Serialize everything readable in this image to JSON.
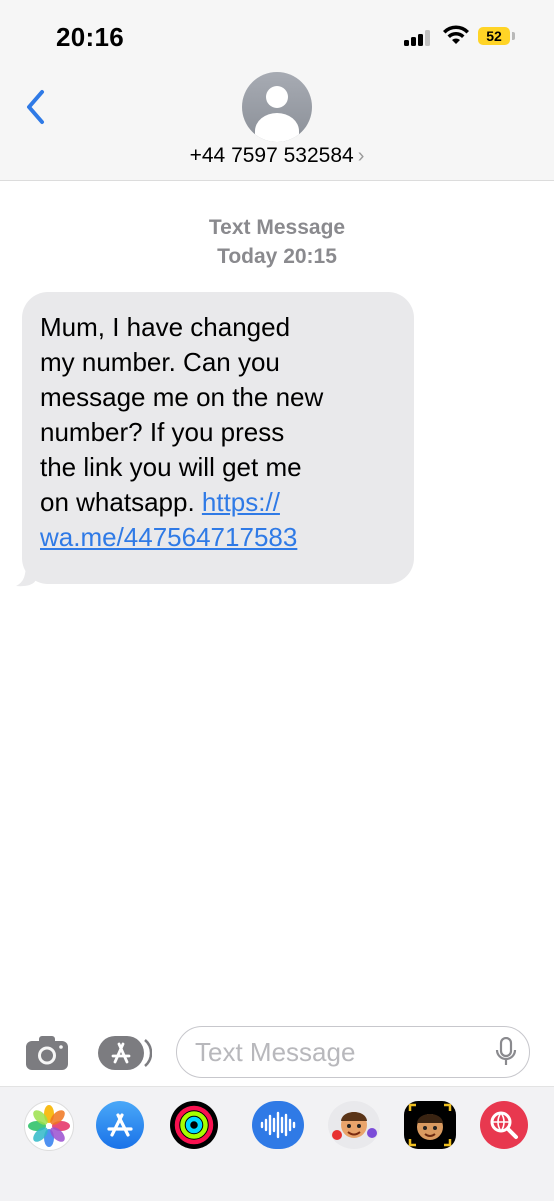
{
  "status_bar": {
    "time": "20:16",
    "battery_level": "52",
    "signal_bars_filled": 3,
    "signal_bars_total": 4,
    "battery_color": "#ffd426"
  },
  "header": {
    "back_icon": "chevron-left-icon",
    "avatar_icon": "person-avatar-icon",
    "contact_number": "+44 7597 532584",
    "chevron": "›"
  },
  "thread": {
    "service_label": "Text Message",
    "timestamp": "Today 20:15",
    "messages": [
      {
        "direction": "incoming",
        "text": "Mum, I have changed\nmy number. Can you\nmessage me on the new\nnumber? If you press\nthe link you will get me\non whatsapp. ",
        "link_text": "https://\nwa.me/447564717583"
      }
    ]
  },
  "compose": {
    "camera_icon": "camera-icon",
    "apps_icon": "app-store-icon",
    "placeholder": "Text Message",
    "value": "",
    "mic_icon": "microphone-icon"
  },
  "app_drawer": {
    "apps": [
      {
        "name": "photos-app-icon"
      },
      {
        "name": "app-store-app-icon"
      },
      {
        "name": "fitness-activity-app-icon"
      },
      {
        "name": "audio-message-app-icon"
      },
      {
        "name": "memoji-stickers-app-icon"
      },
      {
        "name": "animoji-app-icon"
      },
      {
        "name": "web-images-search-app-icon"
      }
    ]
  },
  "colors": {
    "accent_blue": "#2f7ae6",
    "bubble_gray": "#e9e9eb",
    "secondary_text": "#8a8a8e"
  }
}
